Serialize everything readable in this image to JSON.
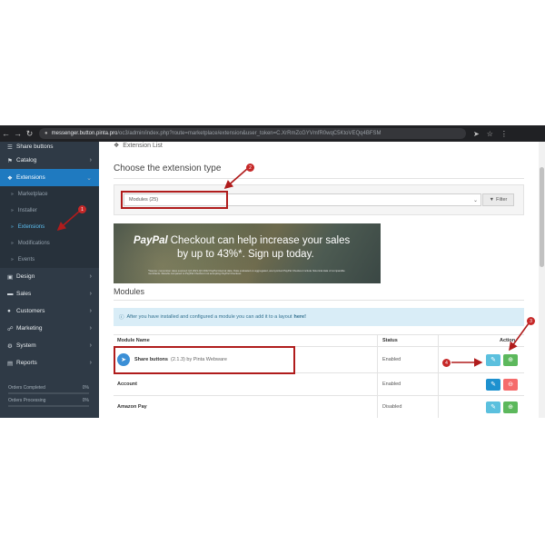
{
  "browser": {
    "host": "messenger.button.pinta.pro",
    "path": "/oc3/admin/index.php?route=marketplace/extension&user_token=C.XrRmZcGYVmfR0wqC5KtoVEQq4BFSM"
  },
  "sidebar": {
    "items": [
      {
        "label": "Share buttons",
        "icon": "share-icon"
      },
      {
        "label": "Catalog",
        "icon": "tag-icon"
      },
      {
        "label": "Extensions",
        "icon": "puzzle-icon"
      },
      {
        "label": "Design",
        "icon": "monitor-icon"
      },
      {
        "label": "Sales",
        "icon": "cart-icon"
      },
      {
        "label": "Customers",
        "icon": "user-icon"
      },
      {
        "label": "Marketing",
        "icon": "share-icon"
      },
      {
        "label": "System",
        "icon": "gear-icon"
      },
      {
        "label": "Reports",
        "icon": "chart-icon"
      }
    ],
    "subitems": [
      {
        "label": "Marketplace"
      },
      {
        "label": "Installer"
      },
      {
        "label": "Extensions"
      },
      {
        "label": "Modifications"
      },
      {
        "label": "Events"
      }
    ],
    "stats": [
      {
        "label": "Orders Completed",
        "value": "0%",
        "progress": 0
      },
      {
        "label": "Orders Processing",
        "value": "0%",
        "progress": 0
      }
    ]
  },
  "main": {
    "panel_title": "Extension List",
    "section_title": "Choose the extension type",
    "filter": {
      "selected": "Modules (25)",
      "button": "Filter"
    },
    "banner": {
      "brand": "PayPal",
      "line1": "Checkout can help increase your sales",
      "line2": "by up to 43%*. Sign up today.",
      "fine": "*Source: conversion rates sourced: Q4 2021-Q3 2022 PayPal internal data. Data evaluated on aggregated, anonymized PayPal Checkout include historical data of comparable merchants. Results compared to PayPal Checkout not accepting PayPal Checkout."
    },
    "modules_heading": "Modules",
    "alert": {
      "text": "After you have installed and configured a module you can add it to a layout",
      "link": "here!"
    },
    "table": {
      "headers": {
        "name": "Module Name",
        "status": "Status",
        "action": "Action"
      },
      "rows": [
        {
          "name": "Share buttons",
          "meta": "(2.1.3) by Pinta Webware",
          "status": "Enabled"
        },
        {
          "name": "Account",
          "meta": "",
          "status": "Enabled"
        },
        {
          "name": "Amazon Pay",
          "meta": "",
          "status": "Disabled"
        }
      ]
    }
  },
  "annotations": [
    "1",
    "2",
    "3",
    "4"
  ],
  "colors": {
    "sidebar": "#2f3a46",
    "active": "#1f7ac0",
    "annotation": "#b01c1c",
    "alert_bg": "#d9edf7"
  }
}
